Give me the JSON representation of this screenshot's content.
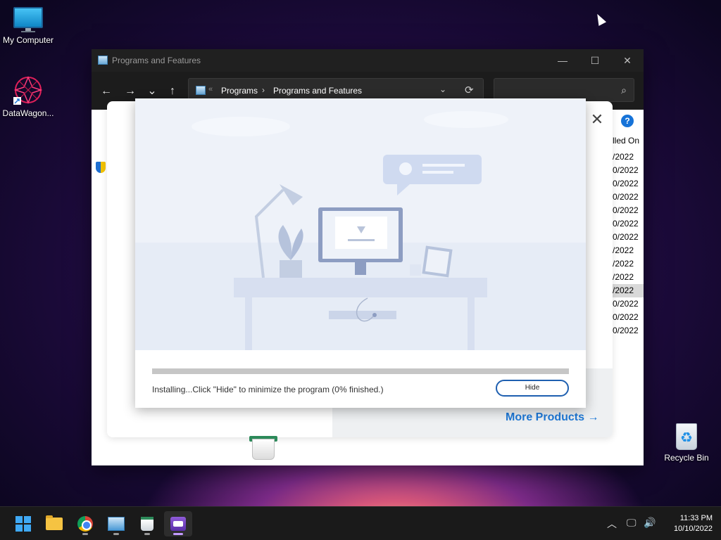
{
  "desktop": {
    "icons": [
      {
        "label": "My Computer"
      },
      {
        "label": "DataWagon..."
      },
      {
        "label": "Recycle Bin"
      }
    ]
  },
  "window": {
    "title": "Programs and Features",
    "controls": {
      "minimize": "—",
      "maximize": "☐",
      "close": "✕"
    },
    "nav": {
      "back": "←",
      "forward": "→",
      "recent": "⌄",
      "up": "↑"
    },
    "address": {
      "chevron": "«",
      "crumbs": [
        "Programs",
        "Programs and Features"
      ],
      "separator": "›",
      "dropdown": "⌄",
      "refresh": "⟳"
    },
    "search": {
      "placeholder": "",
      "icon": "search-icon"
    },
    "help_label": "?",
    "column_header": "lled On",
    "dates": [
      "/2022",
      "0/2022",
      "0/2022",
      "0/2022",
      "0/2022",
      "0/2022",
      "0/2022",
      "/2022",
      "/2022",
      "/2022",
      "/2022",
      "0/2022",
      "0/2022",
      "0/2022"
    ],
    "selected_date_index": 10
  },
  "installer": {
    "close_label": "✕",
    "more_products_label": "More Products",
    "more_products_arrow": "→",
    "dialog": {
      "progress_percent": 0,
      "status_text": "Installing...Click \"Hide\" to minimize the program (0% finished.)",
      "hide_button_label": "Hide"
    }
  },
  "taskbar": {
    "apps": [
      {
        "name": "start",
        "icon": "windows-logo-icon"
      },
      {
        "name": "file-explorer",
        "icon": "folder-icon"
      },
      {
        "name": "chrome",
        "icon": "chrome-icon"
      },
      {
        "name": "control-panel",
        "icon": "control-panel-icon"
      },
      {
        "name": "cleaner",
        "icon": "bin-icon"
      },
      {
        "name": "installer",
        "icon": "box-icon",
        "active": true
      }
    ],
    "tray": {
      "chevron": "︿",
      "network": "🖵",
      "volume": "🔊"
    },
    "clock": {
      "time": "11:33 PM",
      "date": "10/10/2022"
    }
  },
  "colors": {
    "accent": "#1e78d6",
    "titlebar": "#202020",
    "taskbar": "#1a1a1a"
  }
}
